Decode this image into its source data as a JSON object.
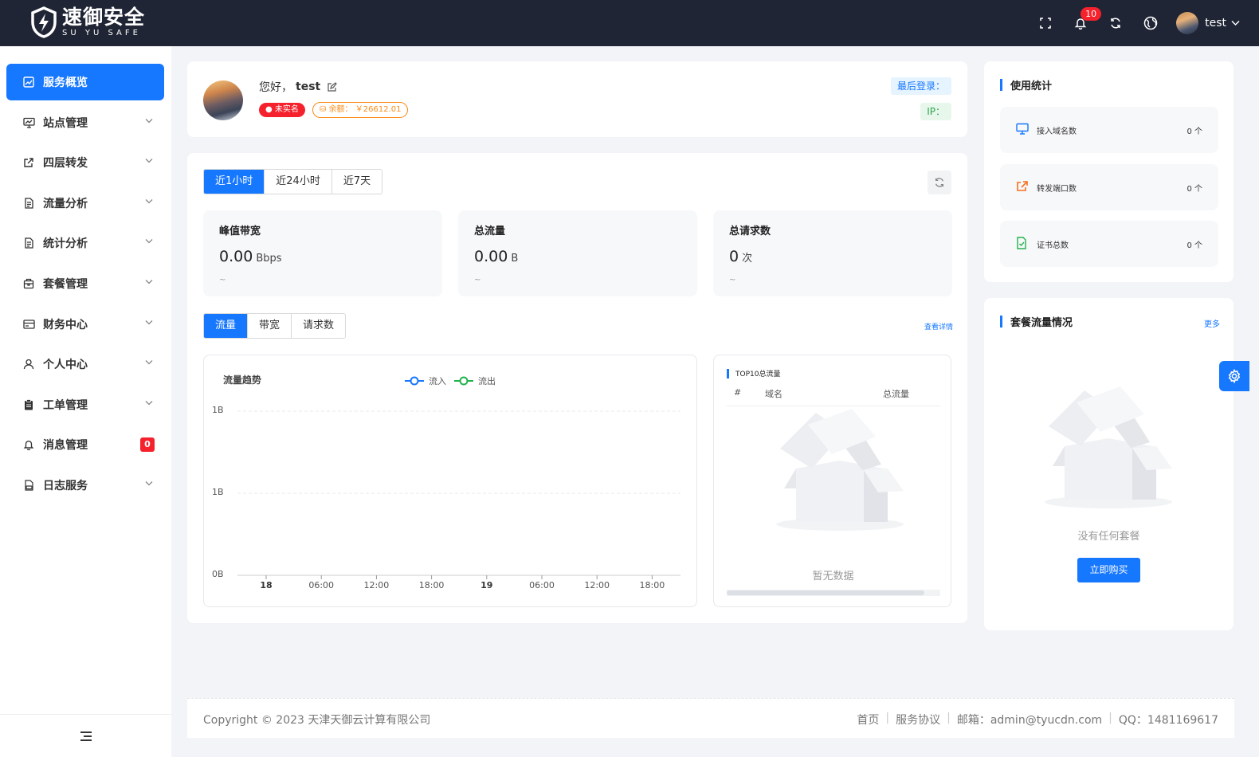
{
  "header": {
    "brand_cn": "速御安全",
    "brand_en": "SU YU SAFE",
    "notification_count": "10",
    "username": "test"
  },
  "sidebar": {
    "items": [
      {
        "label": "服务概览",
        "icon": "chart-icon",
        "active": true
      },
      {
        "label": "站点管理",
        "icon": "monitor-icon"
      },
      {
        "label": "四层转发",
        "icon": "share-icon"
      },
      {
        "label": "流量分析",
        "icon": "document-icon"
      },
      {
        "label": "统计分析",
        "icon": "document-icon"
      },
      {
        "label": "套餐管理",
        "icon": "package-icon"
      },
      {
        "label": "财务中心",
        "icon": "card-icon"
      },
      {
        "label": "个人中心",
        "icon": "user-icon"
      },
      {
        "label": "工单管理",
        "icon": "clipboard-icon"
      },
      {
        "label": "消息管理",
        "icon": "bell-icon",
        "badge": "0"
      },
      {
        "label": "日志服务",
        "icon": "log-icon"
      }
    ]
  },
  "welcome": {
    "greeting": "您好，",
    "username": "test",
    "verify_tag": "未实名",
    "balance_tag": "余额： ￥26612.01",
    "last_login_label": "最后登录：",
    "ip_label": "IP："
  },
  "overview": {
    "time_tabs": [
      "近1小时",
      "近24小时",
      "近7天"
    ],
    "stats": [
      {
        "title": "峰值带宽",
        "value": "0.00",
        "unit": "Bbps",
        "range": "~"
      },
      {
        "title": "总流量",
        "value": "0.00",
        "unit": "B",
        "range": "~"
      },
      {
        "title": "总请求数",
        "value": "0",
        "unit": "次",
        "range": "~"
      }
    ],
    "metric_tabs": [
      "流量",
      "带宽",
      "请求数"
    ],
    "detail_link": "查看详情",
    "top10": {
      "title": "TOP10总流量",
      "columns": [
        "#",
        "域名",
        "总流量"
      ],
      "empty_text": "暂无数据"
    }
  },
  "chart_data": {
    "type": "line",
    "title": "流量趋势",
    "series": [
      {
        "name": "流入",
        "color": "#1677ff",
        "values": []
      },
      {
        "name": "流出",
        "color": "#22b24c",
        "values": []
      }
    ],
    "x_ticks": [
      "18",
      "06:00",
      "12:00",
      "18:00",
      "19",
      "06:00",
      "12:00",
      "18:00"
    ],
    "y_ticks": [
      "1B",
      "1B",
      "0B"
    ],
    "grid": true,
    "legend": "top-center"
  },
  "usage": {
    "title": "使用统计",
    "rows": [
      {
        "label": "接入域名数",
        "value": "0 个",
        "icon": "monitor-icon",
        "color": "#1677ff"
      },
      {
        "label": "转发端口数",
        "value": "0 个",
        "icon": "share-icon",
        "color": "#fa6d1c"
      },
      {
        "label": "证书总数",
        "value": "0 个",
        "icon": "certificate-icon",
        "color": "#22b24c"
      }
    ]
  },
  "package": {
    "title": "套餐流量情况",
    "more": "更多",
    "empty_text": "没有任何套餐",
    "buy_button": "立即购买"
  },
  "footer": {
    "copyright": "Copyright © 2023 天津天御云计算有限公司",
    "links": [
      "首页",
      "服务协议",
      "邮箱：admin@tyucdn.com",
      "QQ：1481169617"
    ]
  },
  "colors": {
    "primary": "#1677ff",
    "header_bg": "#1f2535",
    "danger": "#f5222d",
    "warning": "#fa8c16",
    "success": "#2ba44a"
  }
}
